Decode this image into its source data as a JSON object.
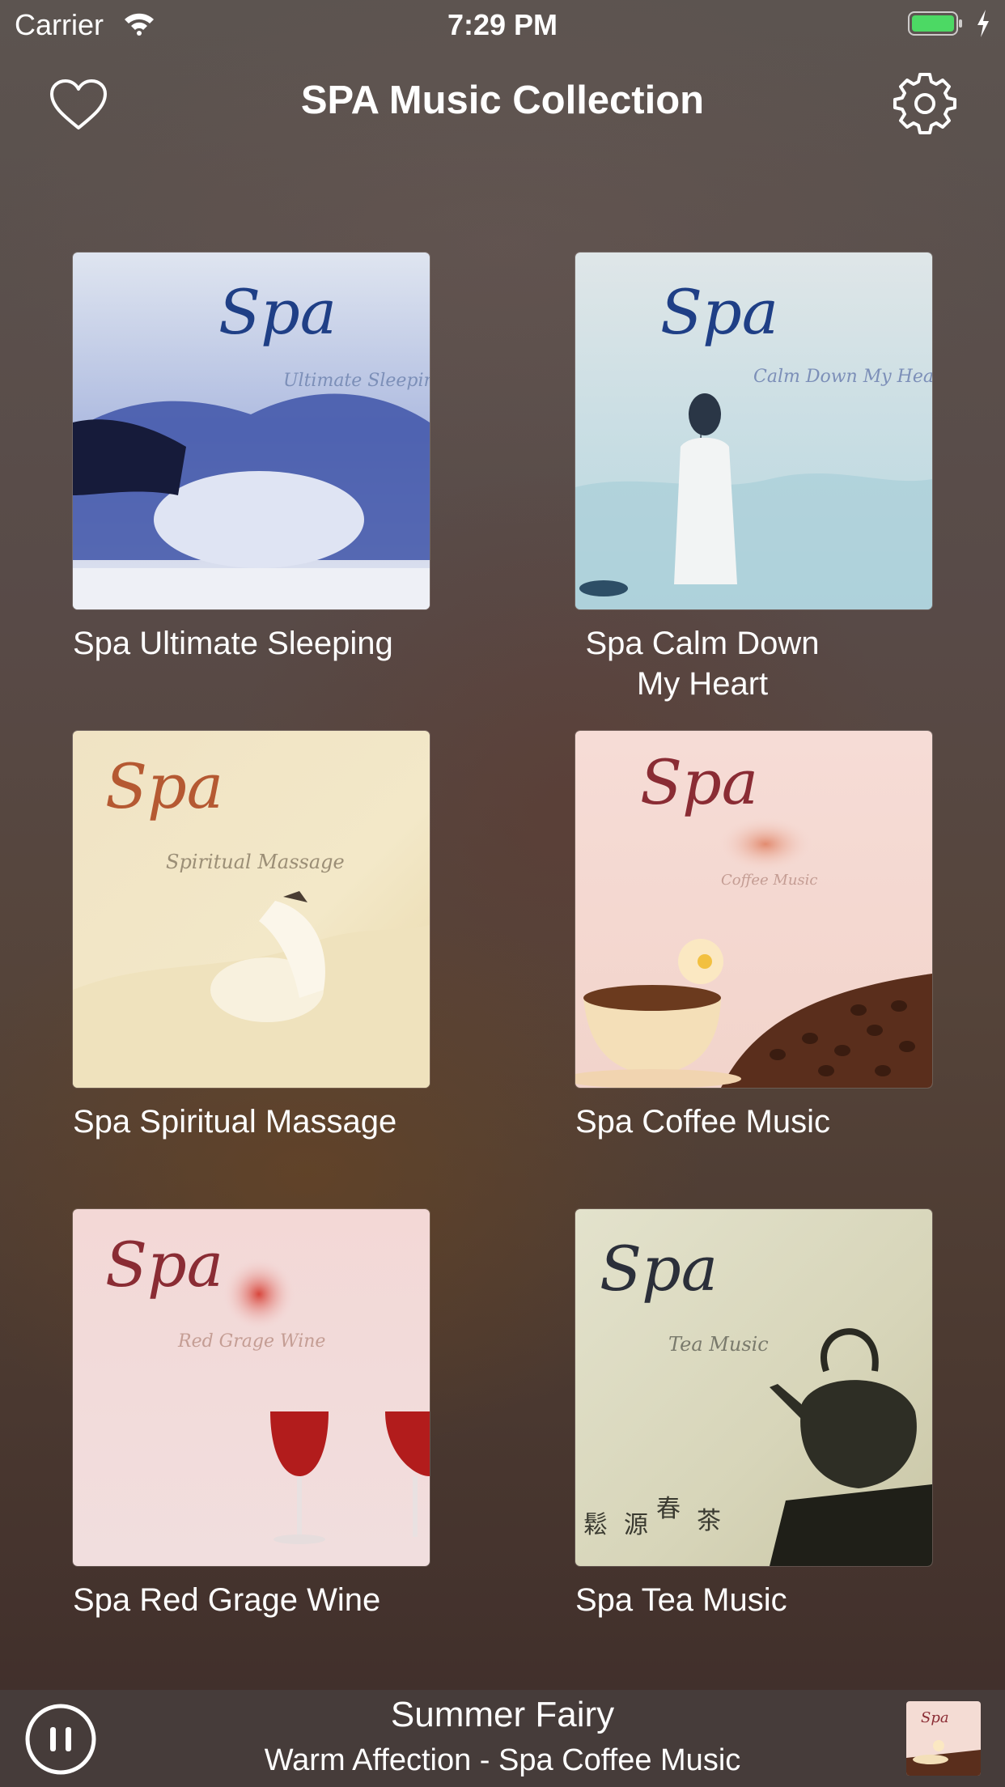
{
  "status_bar": {
    "carrier": "Carrier",
    "time": "7:29 PM"
  },
  "header": {
    "title": "SPA Music Collection",
    "favorite_icon": "heart-icon",
    "settings_icon": "gear-icon"
  },
  "albums": [
    {
      "title": "Spa Ultimate Sleeping",
      "cover_subtitle": "Ultimate Sleeping"
    },
    {
      "title_line1": "Spa Calm Down",
      "title_line2": "My Heart",
      "cover_subtitle": "Calm Down My Heart"
    },
    {
      "title": "Spa Spiritual Massage",
      "cover_subtitle": "Spiritual Massage"
    },
    {
      "title": "Spa Coffee Music",
      "cover_subtitle": "Coffee Music"
    },
    {
      "title": "Spa Red Grage Wine",
      "cover_subtitle": "Red Grage Wine"
    },
    {
      "title": "Spa Tea Music",
      "cover_subtitle": "Tea Music"
    }
  ],
  "cover_logo": "Spa",
  "now_playing": {
    "track": "Summer Fairy",
    "subtitle": "Warm Affection - Spa Coffee Music",
    "thumb_logo": "Spa",
    "control_icon": "pause-icon"
  }
}
